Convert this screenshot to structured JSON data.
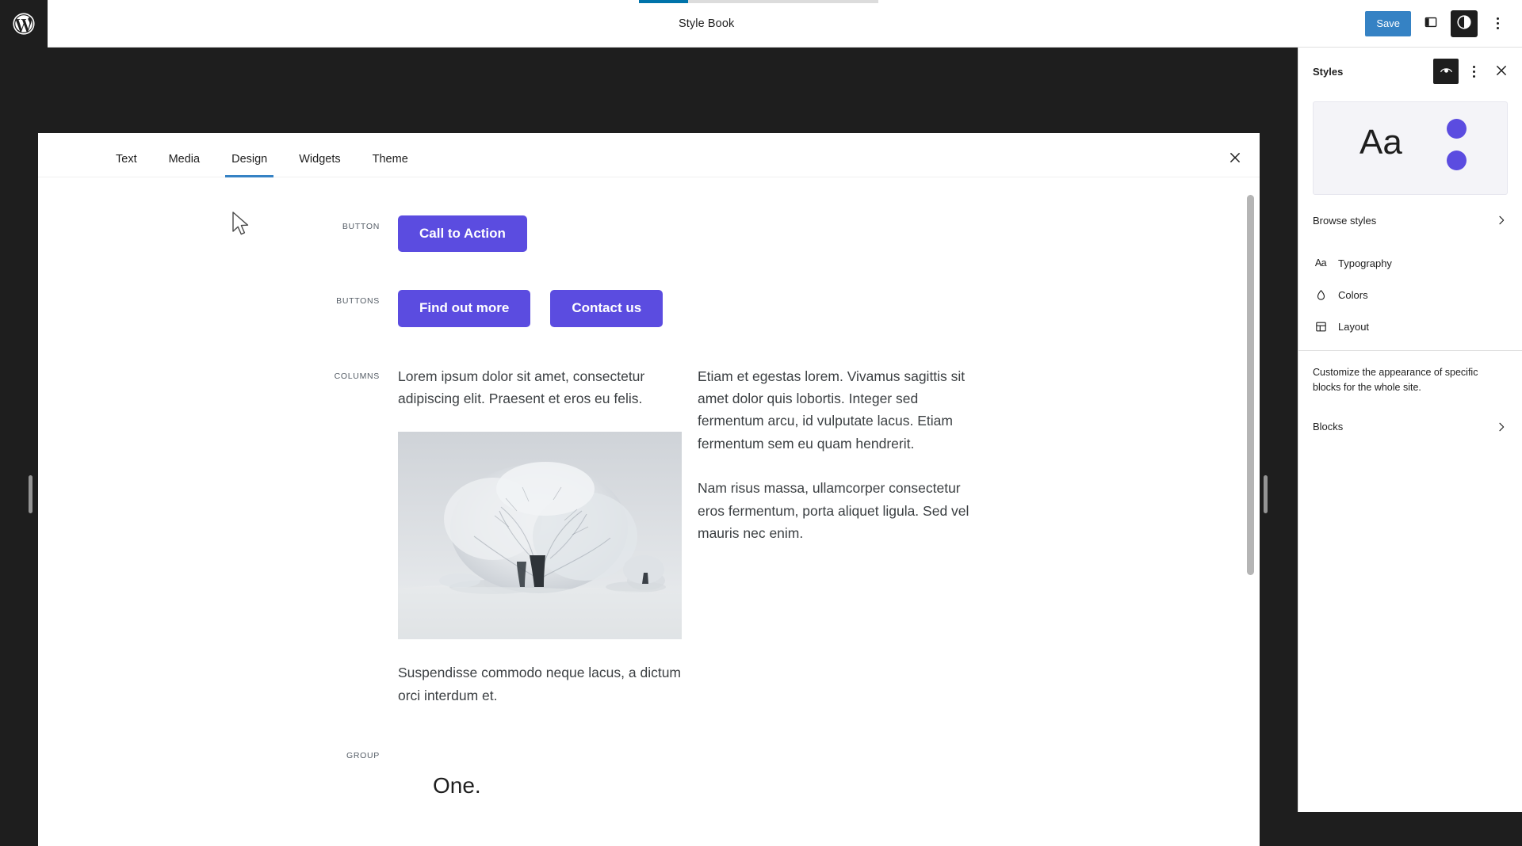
{
  "topbar": {
    "logo_icon": "wordpress-logo-icon",
    "title": "Style Book",
    "save_label": "Save",
    "sidebar_toggle_icon": "sidebar-panel-icon",
    "styles_toggle_icon": "contrast-styles-icon",
    "options_icon": "kebab-menu-icon",
    "accent_color": "#3582c4",
    "progress_color": "#0073aa"
  },
  "stylebook": {
    "close_icon": "close-icon",
    "tabs": [
      {
        "label": "Text",
        "active": false
      },
      {
        "label": "Media",
        "active": false
      },
      {
        "label": "Design",
        "active": true
      },
      {
        "label": "Widgets",
        "active": false
      },
      {
        "label": "Theme",
        "active": false
      }
    ],
    "rows": {
      "button": {
        "label": "BUTTON",
        "cta_label": "Call to Action"
      },
      "buttons": {
        "label": "BUTTONS",
        "primary_label": "Find out more",
        "secondary_label": "Contact us"
      },
      "columns": {
        "label": "COLUMNS",
        "left_p1": "Lorem ipsum dolor sit amet, consectetur adipiscing elit. Praesent et eros eu felis.",
        "image_alt": "snow-covered-tree-photo",
        "left_p2": "Suspendisse commodo neque lacus, a dictum orci interdum et.",
        "right_p1": "Etiam et egestas lorem. Vivamus sagittis sit amet dolor quis lobortis. Integer sed fermentum arcu, id vulputate lacus. Etiam fermentum sem eu quam hendrerit.",
        "right_p2": "Nam risus massa, ullamcorper consectetur eros fermentum, porta aliquet ligula. Sed vel mauris nec enim."
      },
      "group": {
        "label": "GROUP",
        "heading": "One."
      }
    },
    "button_color": "#5b4ce0"
  },
  "styles_sidebar": {
    "title": "Styles",
    "preview_icon_eye": "eye-preview-icon",
    "options_icon": "kebab-menu-icon",
    "close_icon": "close-icon",
    "preview": {
      "sample_text": "Aa",
      "dot_color": "#5b4ce0"
    },
    "browse": {
      "label": "Browse styles",
      "chevron_icon": "chevron-right-icon"
    },
    "menu": [
      {
        "label": "Typography",
        "icon": "typography-aa-icon"
      },
      {
        "label": "Colors",
        "icon": "color-droplet-icon"
      },
      {
        "label": "Layout",
        "icon": "layout-grid-icon"
      }
    ],
    "description": "Customize the appearance of specific blocks for the whole site.",
    "blocks": {
      "label": "Blocks",
      "chevron_icon": "chevron-right-icon"
    }
  },
  "canvas": {
    "left_resize_handle": "resize-handle-left",
    "right_resize_handle": "resize-handle-right",
    "cursor_icon": "mouse-pointer-cursor"
  }
}
